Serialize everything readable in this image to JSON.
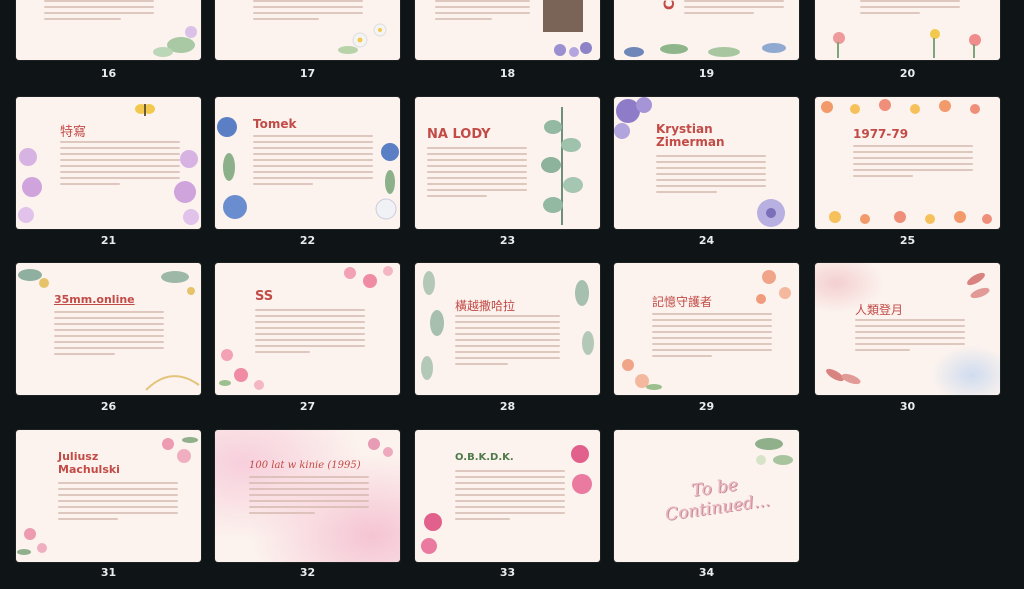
{
  "slides": [
    {
      "number": "16",
      "title": ""
    },
    {
      "number": "17",
      "title": ""
    },
    {
      "number": "18",
      "title": ""
    },
    {
      "number": "19",
      "title": "CUR"
    },
    {
      "number": "20",
      "title": ""
    },
    {
      "number": "21",
      "title": "特寫"
    },
    {
      "number": "22",
      "title": "Tomek"
    },
    {
      "number": "23",
      "title": "NA LODY"
    },
    {
      "number": "24",
      "title": "Krystian Zimerman"
    },
    {
      "number": "25",
      "title": "1977-79"
    },
    {
      "number": "26",
      "title": "35mm.online"
    },
    {
      "number": "27",
      "title": "SS"
    },
    {
      "number": "28",
      "title": "橫越撒哈拉"
    },
    {
      "number": "29",
      "title": "記憶守護者"
    },
    {
      "number": "30",
      "title": "人類登月"
    },
    {
      "number": "31",
      "title": "Juliusz Machulski"
    },
    {
      "number": "32",
      "title": "100 lat w kinie (1995)"
    },
    {
      "number": "33",
      "title": "O.B.K.D.K."
    },
    {
      "number": "34",
      "title": "To be Continued..."
    }
  ],
  "colors": {
    "background": "#0f1417",
    "slide": "#fcf3ee",
    "title": "#c24b47",
    "number": "#e9ecef"
  }
}
